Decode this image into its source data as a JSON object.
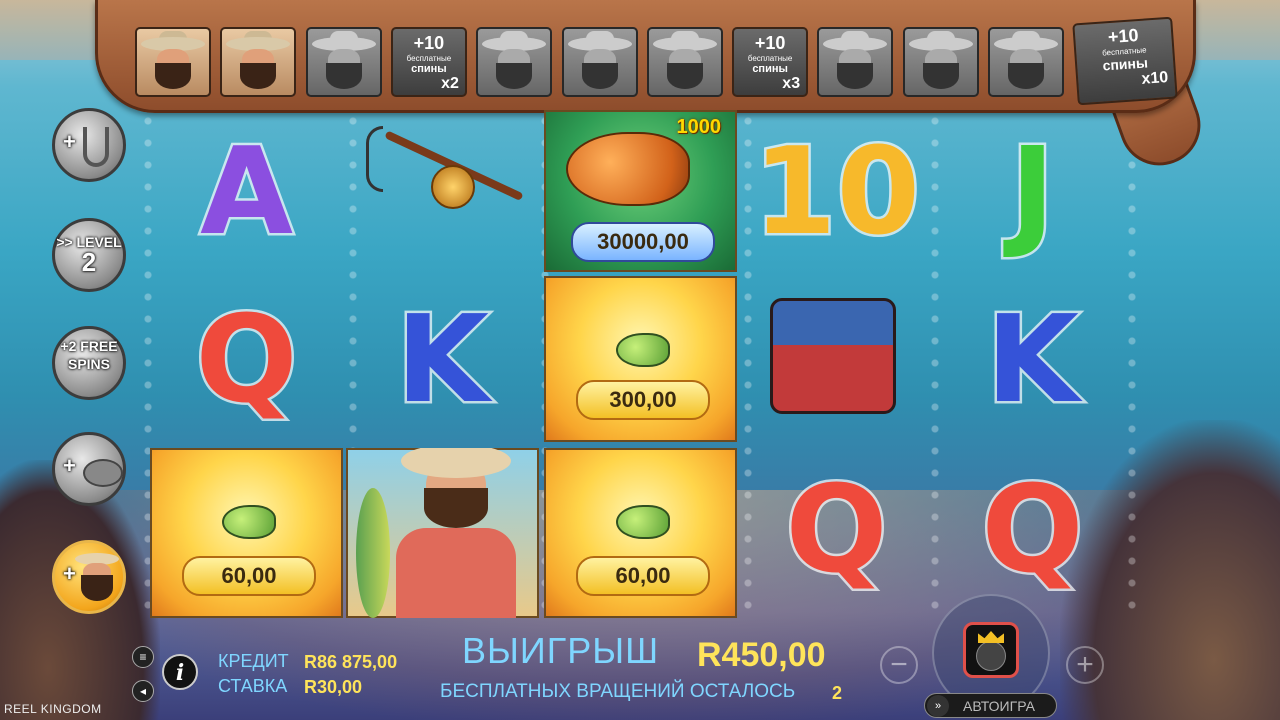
{
  "progress_bar": {
    "slots": [
      {
        "type": "fisherman",
        "state": "active"
      },
      {
        "type": "fisherman",
        "state": "active"
      },
      {
        "type": "fisherman",
        "state": "inactive"
      },
      {
        "type": "bonus",
        "plus": "+10",
        "small": "бесплатные",
        "word": "спины",
        "mult": "x2"
      },
      {
        "type": "fisherman",
        "state": "inactive"
      },
      {
        "type": "fisherman",
        "state": "inactive"
      },
      {
        "type": "fisherman",
        "state": "inactive"
      },
      {
        "type": "bonus",
        "plus": "+10",
        "small": "бесплатные",
        "word": "спины",
        "mult": "x3"
      },
      {
        "type": "fisherman",
        "state": "inactive"
      },
      {
        "type": "fisherman",
        "state": "inactive"
      },
      {
        "type": "fisherman",
        "state": "inactive"
      }
    ],
    "final_bonus": {
      "plus": "+10",
      "small": "бесплатные",
      "word": "спины",
      "mult": "x10"
    }
  },
  "side_buttons": [
    {
      "name": "extra-hook-button",
      "icon": "hook-icon",
      "line1": "",
      "line2": ""
    },
    {
      "name": "level-button",
      "icon": "level-icon",
      "line1": ">> LEVEL",
      "line2": "2"
    },
    {
      "name": "free-spins-button",
      "icon": "free-spins-icon",
      "line1": "+2 FREE",
      "line2": "SPINS"
    },
    {
      "name": "extra-fish-button",
      "icon": "fish-icon",
      "line1": "",
      "line2": ""
    },
    {
      "name": "extra-fisherman-button",
      "icon": "fisherman-icon",
      "line1": "",
      "line2": ""
    }
  ],
  "reels": {
    "symbols": {
      "r0c0": "A",
      "r0c3": "10",
      "r0c4": "J",
      "r1c0": "Q",
      "r1c1": "K",
      "r1c4": "K",
      "r2c3": "Q",
      "r2c4": "Q"
    },
    "money_values": {
      "big_fish": "30000,00",
      "big_fish_mult": "1000",
      "fish_r1c2": "300,00",
      "fish_r2c0": "60,00",
      "fish_r2c2": "60,00"
    },
    "colors": {
      "A": "#8b4fe0",
      "10": "#f7b92b",
      "J": "#3ccd3a",
      "Q": "#ef4a3c",
      "K": "#3553d8"
    }
  },
  "bottom": {
    "credit_label": "КРЕДИТ",
    "credit_value": "R86 875,00",
    "bet_label": "СТАВКА",
    "bet_value": "R30,00",
    "win_label": "ВЫИГРЫШ",
    "win_value": "R450,00",
    "free_spins_label": "БЕСПЛАТНЫХ ВРАЩЕНИЙ ОСТАЛОСЬ",
    "free_spins_value": "2",
    "autoplay_label": "АВТОИГРА",
    "minus": "−",
    "plus": "+",
    "info": "i",
    "brand": "REEL KINGDOM"
  }
}
